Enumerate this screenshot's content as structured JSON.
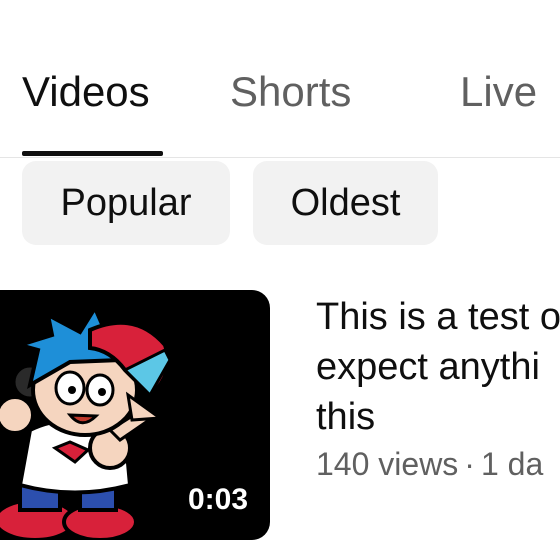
{
  "tabs": {
    "items": [
      {
        "label": "Videos",
        "active": true
      },
      {
        "label": "Shorts",
        "active": false
      },
      {
        "label": "Live",
        "active": false
      }
    ]
  },
  "chips": {
    "items": [
      {
        "label": "Popular"
      },
      {
        "label": "Oldest"
      }
    ]
  },
  "video": {
    "title_lines": [
      "This is a test o",
      "expect anythi",
      "this"
    ],
    "views": "140 views",
    "separator": "·",
    "age": "1 da",
    "duration": "0:03",
    "thumbnail_icon": "cartoon-character-thumbnail"
  },
  "colors": {
    "accent": "#0f0f0f",
    "secondary_text": "#606060",
    "chip_bg": "#f2f2f2"
  }
}
